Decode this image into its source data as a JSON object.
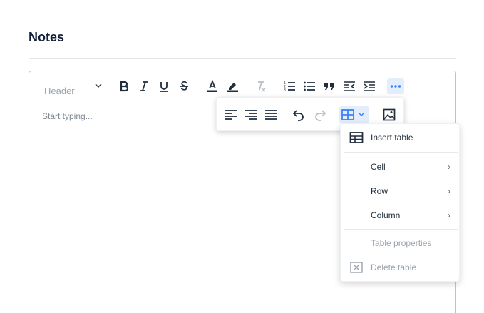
{
  "page": {
    "title": "Notes"
  },
  "editor": {
    "header_select": "Header",
    "placeholder": "Start typing...",
    "toolbar": [
      {
        "name": "bold-icon"
      },
      {
        "name": "italic-icon"
      },
      {
        "name": "underline-icon"
      },
      {
        "name": "strikethrough-icon"
      },
      {
        "name": "text-color-icon"
      },
      {
        "name": "highlight-icon"
      },
      {
        "name": "clear-format-icon"
      },
      {
        "name": "ordered-list-icon"
      },
      {
        "name": "bullet-list-icon"
      },
      {
        "name": "quote-icon"
      },
      {
        "name": "outdent-icon"
      },
      {
        "name": "indent-icon"
      },
      {
        "name": "more-icon"
      }
    ],
    "secondary_toolbar": [
      {
        "name": "align-left-icon"
      },
      {
        "name": "align-right-icon"
      },
      {
        "name": "align-justify-icon"
      },
      {
        "name": "undo-icon"
      },
      {
        "name": "redo-icon"
      },
      {
        "name": "table-icon"
      },
      {
        "name": "image-icon"
      }
    ]
  },
  "table_menu": {
    "insert_table": "Insert table",
    "cell": "Cell",
    "row": "Row",
    "column": "Column",
    "table_properties": "Table properties",
    "delete_table": "Delete table",
    "submenu_arrow": "›"
  },
  "colors": {
    "accent": "#3b82f6",
    "active_bg": "#e3edfb",
    "editor_border": "#e8b4a8",
    "text": "#1f2d3d",
    "muted": "#9aa3ad"
  }
}
